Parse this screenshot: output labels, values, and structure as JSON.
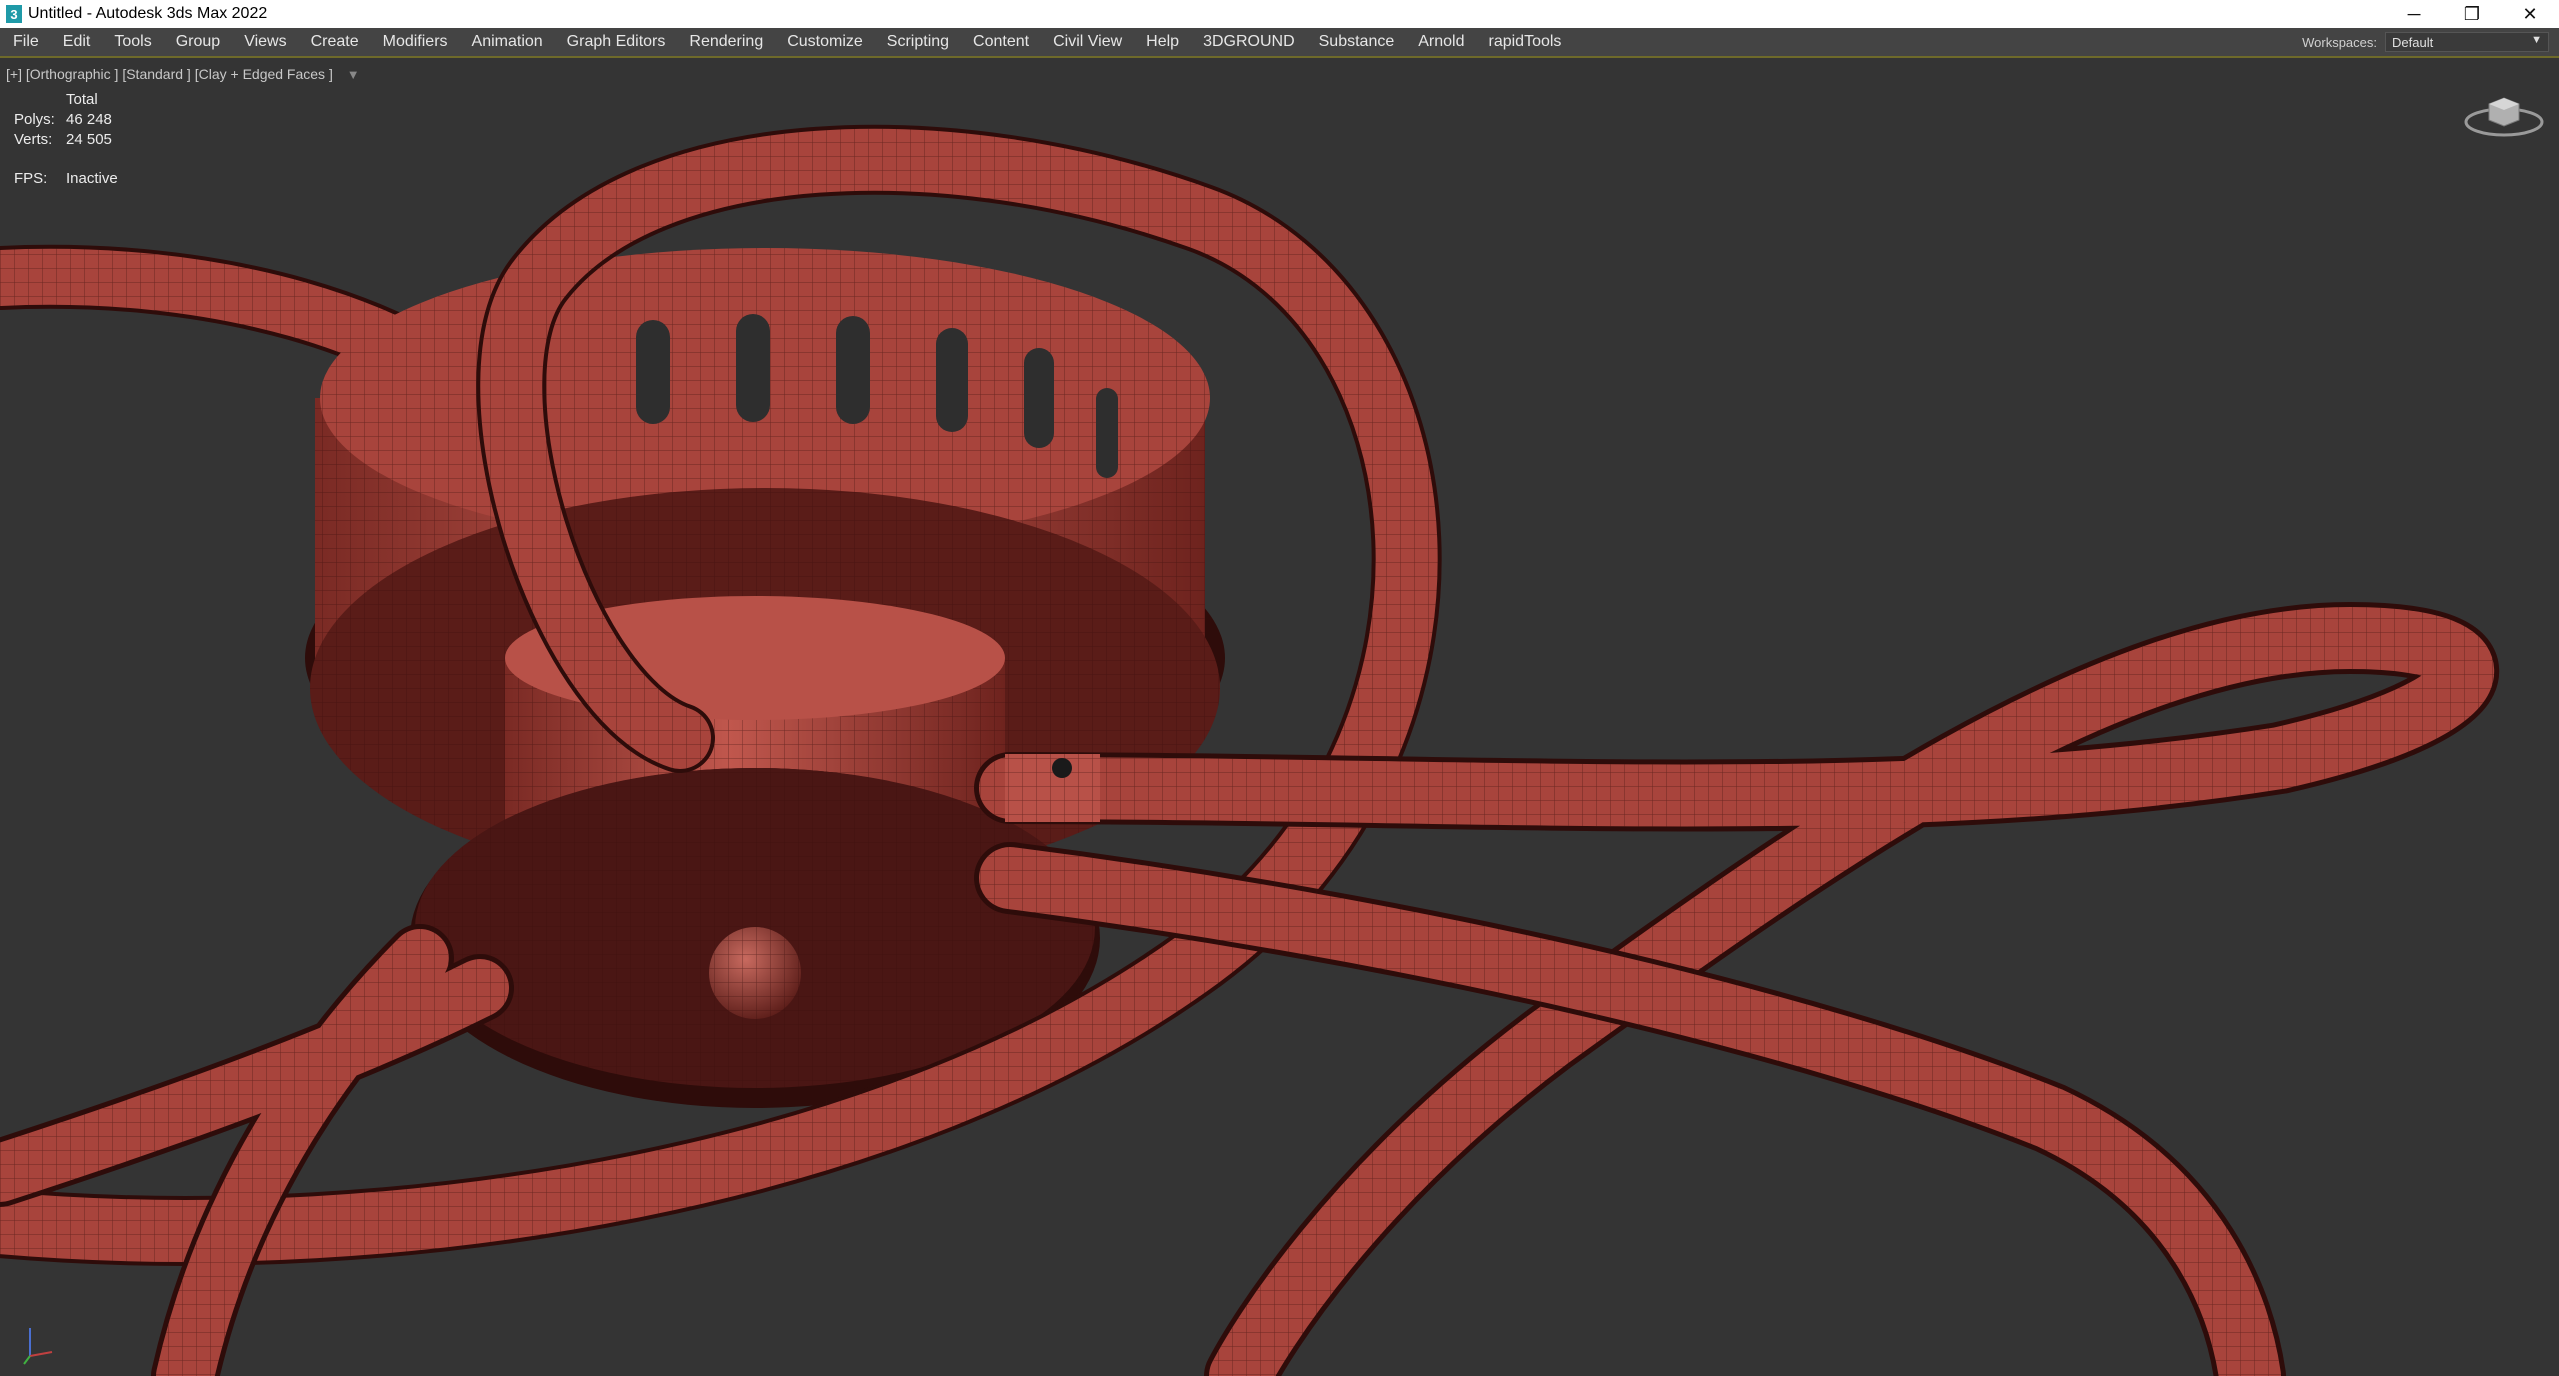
{
  "window": {
    "title": "Untitled - Autodesk 3ds Max 2022",
    "app_icon_glyph": "3",
    "minimize_glyph": "─",
    "restore_glyph": "❐",
    "close_glyph": "✕"
  },
  "menu": {
    "items": [
      "File",
      "Edit",
      "Tools",
      "Group",
      "Views",
      "Create",
      "Modifiers",
      "Animation",
      "Graph Editors",
      "Rendering",
      "Customize",
      "Scripting",
      "Content",
      "Civil View",
      "Help",
      "3DGROUND",
      "Substance",
      "Arnold",
      "rapidTools"
    ],
    "workspaces_label": "Workspaces:",
    "workspace_value": "Default"
  },
  "viewport": {
    "label": "[+] [Orthographic ] [Standard ] [Clay + Edged Faces ]",
    "stats": {
      "header": "Total",
      "polys_label": "Polys:",
      "polys_value": "46 248",
      "verts_label": "Verts:",
      "verts_value": "24 505",
      "fps_label": "FPS:",
      "fps_value": "Inactive"
    }
  },
  "colors": {
    "viewport_bg": "#343434",
    "clay": "#a8443c",
    "clay_dark": "#5a1c18",
    "clay_shadow": "#2e0c0a",
    "wire": "#3a0f0c"
  },
  "icons": {
    "viewcube": "viewcube-icon",
    "axis": "axis-tripod-icon",
    "filter": "filter-icon"
  }
}
